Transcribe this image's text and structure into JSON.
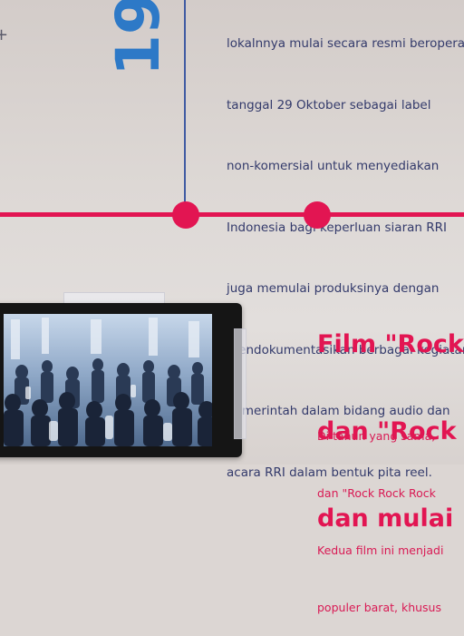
{
  "exhibit": {
    "year_fragment": "19",
    "corner_mark": "+",
    "paragraph_lines": [
      "lokalnnya mulai secara resmi beroperasi",
      "tanggal 29 Oktober sebagai label",
      "non-komersial untuk menyediakan",
      "Indonesia bagi keperluan siaran RRI",
      "juga memulai produksinya dengan",
      "mendokumentasikan berbagai kegiatan",
      "pemerintah dalam bidang audio dan",
      "acara RRI dalam bentuk pita reel."
    ],
    "heading_lines": [
      "Film \"Rock",
      "dan \"Rock",
      "dan mulai"
    ],
    "body_lines": [
      "Di tahun yang sama,",
      "dan \"Rock Rock Rock",
      "Kedua film ini menjadi",
      "populer barat, khusus"
    ],
    "monitor": {
      "screen_content": "black-and-white film footage of a crowd of dancers"
    }
  },
  "colors": {
    "timeline": "#e21552",
    "year": "#2d79c7",
    "paragraph_text": "#333a6b",
    "vertical_line": "#3f5aa2",
    "heading": "#e21552"
  }
}
